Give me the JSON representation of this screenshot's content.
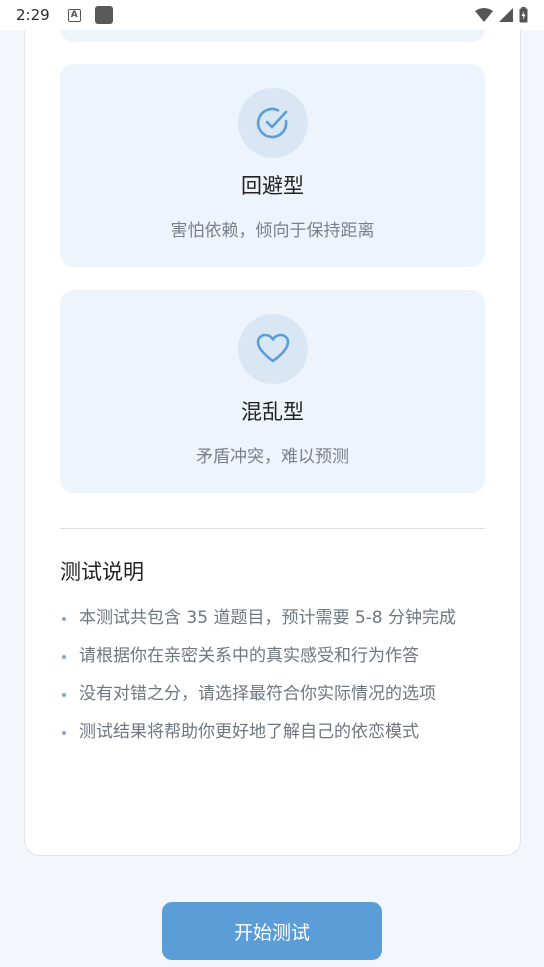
{
  "status_bar": {
    "time": "2:29",
    "a_badge": "A"
  },
  "types": [
    {
      "icon": "check-circle-icon",
      "title": "回避型",
      "description": "害怕依赖，倾向于保持距离"
    },
    {
      "icon": "heart-icon",
      "title": "混乱型",
      "description": "矛盾冲突，难以预测"
    }
  ],
  "instructions": {
    "title": "测试说明",
    "items": [
      "本测试共包含 35 道题目，预计需要 5-8 分钟完成",
      "请根据你在亲密关系中的真实感受和行为作答",
      "没有对错之分，请选择最符合你实际情况的选项",
      "测试结果将帮助你更好地了解自己的依恋模式"
    ]
  },
  "start_button": {
    "label": "开始测试"
  },
  "colors": {
    "accent": "#5b9dd6",
    "card_bg": "#eef4fb",
    "icon_circle": "#d9e6f3"
  }
}
